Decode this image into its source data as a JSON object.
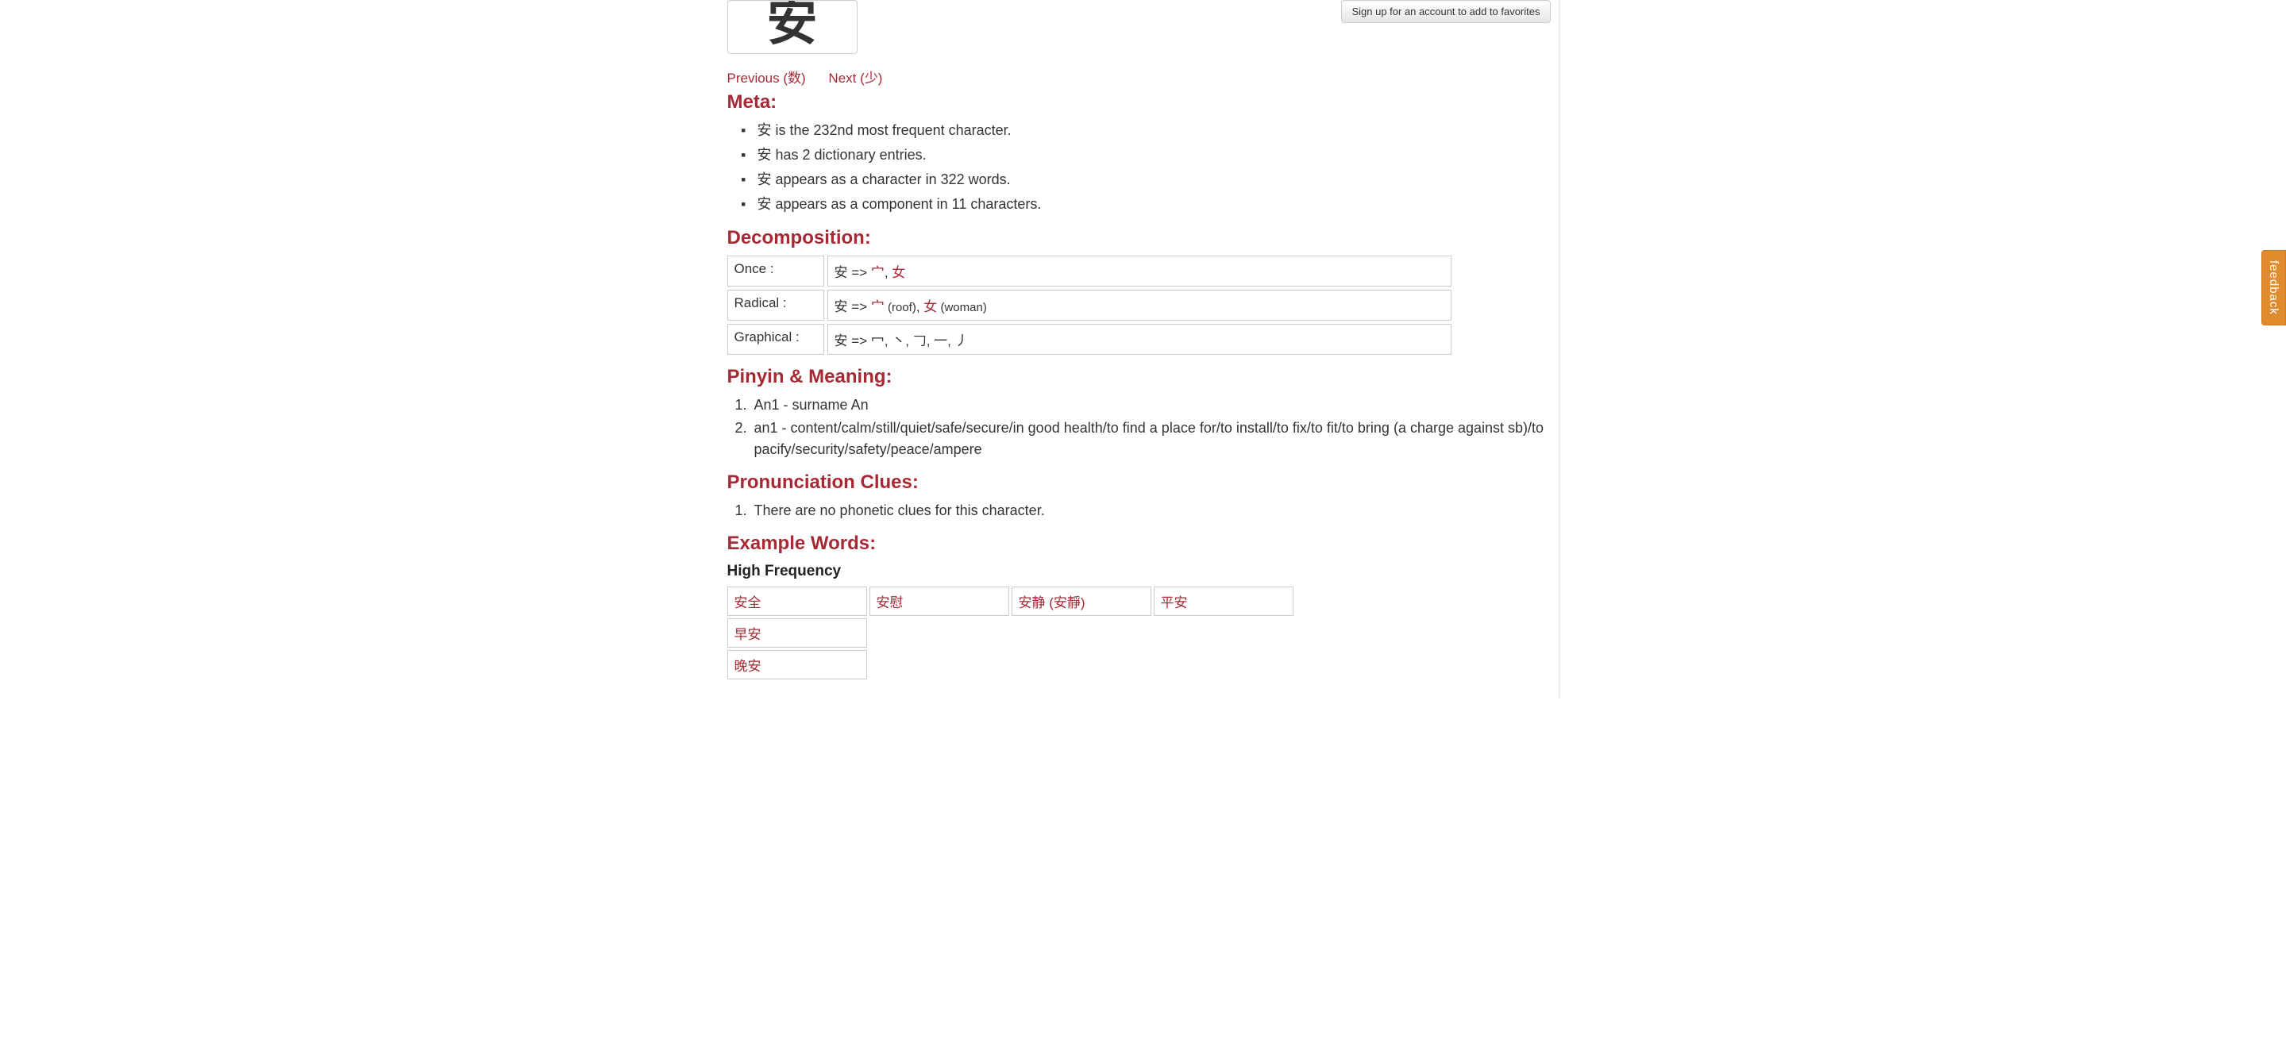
{
  "character": "安",
  "signup_button": "Sign up for an account to add to favorites",
  "nav": {
    "previous": "Previous (数)",
    "next": "Next (少)"
  },
  "sections": {
    "meta": "Meta:",
    "decomposition": "Decomposition:",
    "pinyin_meaning": "Pinyin & Meaning:",
    "pronunciation_clues": "Pronunciation Clues:",
    "example_words": "Example Words:",
    "high_frequency": "High Frequency"
  },
  "meta_items": [
    "安 is the 232nd most frequent character.",
    "安 has 2 dictionary entries.",
    "安 appears as a character in 322 words.",
    "安 appears as a component in 11 characters."
  ],
  "decomposition": {
    "once": {
      "label": "Once :",
      "prefix": "安 => ",
      "parts": [
        {
          "char": "宀",
          "meaning": ""
        },
        {
          "char": "女",
          "meaning": ""
        }
      ]
    },
    "radical": {
      "label": "Radical :",
      "prefix": "安 => ",
      "parts": [
        {
          "char": "宀",
          "meaning": " (roof)"
        },
        {
          "char": "女",
          "meaning": " (woman)"
        }
      ]
    },
    "graphical": {
      "label": "Graphical :",
      "text": "安 => 冖, 丶, 𠃌, 一, 丿"
    }
  },
  "pinyin_meanings": [
    "An1 - surname An",
    "an1 - content/calm/still/quiet/safe/secure/in good health/to find a place for/to install/to fix/to fit/to bring (a charge against sb)/to pacify/security/safety/peace/ampere"
  ],
  "pronunciation_clues": [
    "There are no phonetic clues for this character."
  ],
  "example_words": {
    "high_frequency": [
      "安全",
      "安慰",
      "安静 (安靜)",
      "平安",
      "早安",
      "晚安"
    ]
  },
  "feedback": "feedback"
}
